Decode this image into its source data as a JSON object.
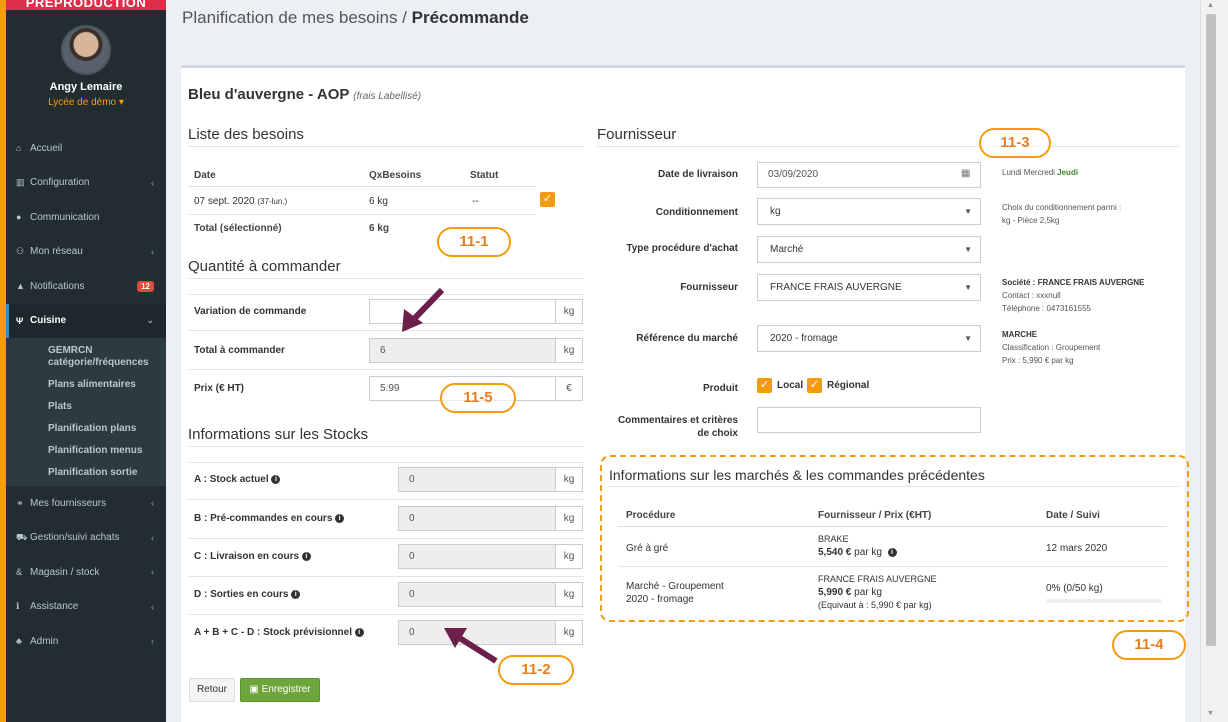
{
  "banner": "PREPRODUCTION",
  "user": {
    "name": "Angy Lemaire",
    "school": "Lycée de démo ▾"
  },
  "nav": [
    {
      "label": "Accueil",
      "icon": "home-icon"
    },
    {
      "label": "Configuration",
      "icon": "bank-icon"
    },
    {
      "label": "Communication",
      "icon": "chat-icon"
    },
    {
      "label": "Mon réseau",
      "icon": "users-icon"
    },
    {
      "label": "Notifications",
      "icon": "bell-icon",
      "badge": "12"
    },
    {
      "label": "Cuisine",
      "icon": "cutlery-icon"
    }
  ],
  "subnav": [
    "GEMRCN catégorie/fréquences",
    "Plans alimentaires",
    "Plats",
    "Planification plans",
    "Planification menus",
    "Planification sortie"
  ],
  "nav2": [
    {
      "label": "Mes fournisseurs",
      "icon": "handshake-icon"
    },
    {
      "label": "Gestion/suivi achats",
      "icon": "cart-icon"
    },
    {
      "label": "Magasin / stock",
      "icon": "cubes-icon"
    },
    {
      "label": "Assistance",
      "icon": "info-icon"
    },
    {
      "label": "Admin",
      "icon": "user-cog-icon"
    }
  ],
  "header": {
    "path": "Planification de mes besoins / ",
    "current": "Précommande"
  },
  "product": {
    "name": "Bleu d'auvergne - AOP",
    "tag": "(frais Labellisé)"
  },
  "besoins": {
    "title": "Liste des besoins",
    "headers": [
      "Date",
      "QxBesoins",
      "Statut"
    ],
    "row": {
      "date": "07 sept. 2020",
      "day": "(37-lun.)",
      "qty": "6 kg",
      "statut": "--"
    },
    "total_label": "Total (sélectionné)",
    "total_value": "6 kg"
  },
  "quantite": {
    "title": "Quantité à commander",
    "variation_label": "Variation de commande",
    "variation_value": "",
    "variation_unit": "kg",
    "total_label": "Total à commander",
    "total_value": "6",
    "total_unit": "kg",
    "prix_label": "Prix (€ HT)",
    "prix_value": "5.99",
    "prix_unit": "€"
  },
  "stocks": {
    "title": "Informations sur les Stocks",
    "rows": [
      {
        "label": "A : Stock actuel",
        "value": "0",
        "unit": "kg"
      },
      {
        "label": "B : Pré-commandes en cours",
        "value": "0",
        "unit": "kg"
      },
      {
        "label": "C : Livraison en cours",
        "value": "0",
        "unit": "kg"
      },
      {
        "label": "D : Sorties en cours",
        "value": "0",
        "unit": "kg"
      },
      {
        "label": "A + B + C - D : Stock prévisionnel",
        "value": "0",
        "unit": "kg"
      }
    ]
  },
  "buttons": {
    "retour": "Retour",
    "save": "Enregistrer"
  },
  "fournisseur": {
    "title": "Fournisseur",
    "date_label": "Date de livraison",
    "date_value": "03/09/2020",
    "cond_label": "Conditionnement",
    "cond_value": "kg",
    "proc_label": "Type procédure d'achat",
    "proc_value": "Marché",
    "four_label": "Fournisseur",
    "four_value": "FRANCE FRAIS AUVERGNE",
    "ref_label": "Référence du marché",
    "ref_value": "2020 - fromage",
    "produit_label": "Produit",
    "local": "Local",
    "regional": "Régional",
    "comment_label_1": "Commentaires et critères",
    "comment_label_2": "de choix",
    "days_plain": "Lundi Mercredi",
    "days_bold": "Jeudi",
    "cond_note_1": "Choix du conditionnement parmi :",
    "cond_note_2": "kg - Pièce 2,5kg",
    "soc_1": "Société : FRANCE FRAIS AUVERGNE",
    "soc_2": "Contact : xxxnull",
    "soc_3": "Téléphone : 0473161555",
    "marche_1": "MARCHE",
    "marche_2": "Classification : Groupement",
    "marche_3": "Prix : 5,990 € par kg"
  },
  "marches": {
    "title": "Informations sur les marchés & les commandes précédentes",
    "headers": [
      "Procédure",
      "Fournisseur / Prix (€HT)",
      "Date / Suivi"
    ],
    "r1": {
      "proc": "Gré à gré",
      "four": "BRAKE",
      "price": "5,540 €",
      "unit": " par kg",
      "date": "12 mars 2020"
    },
    "r2": {
      "proc1": "Marché - Groupement",
      "proc2": "2020 - fromage",
      "four": "FRANCE FRAIS AUVERGNE",
      "price": "5,990 €",
      "unit": " par kg",
      "equiv": "(Equivaut à : 5,990 € par kg)",
      "suivi": "0% (0/50 kg)",
      "progress": 0
    }
  },
  "callouts": {
    "c1": "11-1",
    "c2": "11-2",
    "c3": "11-3",
    "c4": "11-4",
    "c5": "11-5"
  },
  "colors": {
    "accent": "#f39c12",
    "arrow": "#6b1f4a",
    "save": "#6ea53a",
    "sidebar": "#222d32"
  }
}
